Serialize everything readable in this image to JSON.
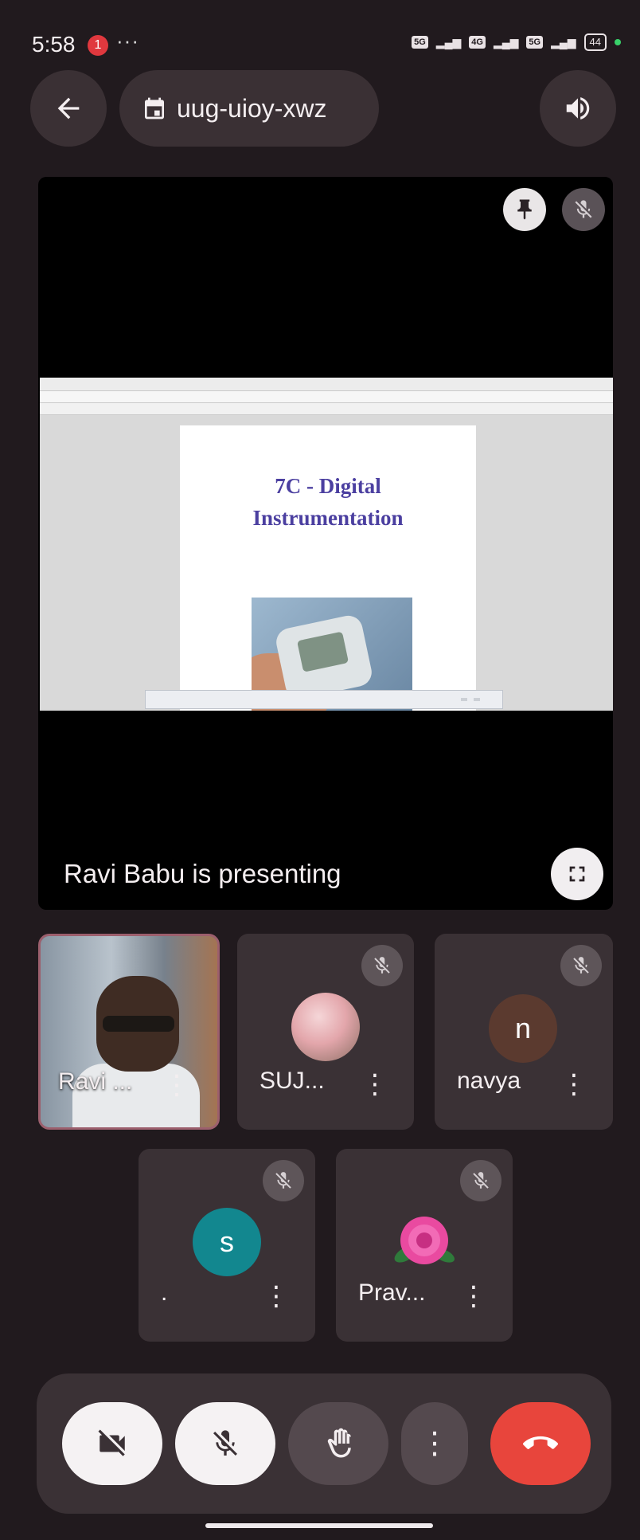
{
  "status_bar": {
    "time": "5:58",
    "notification_count": "1",
    "more": "···",
    "network_chips": [
      "5G",
      "4G",
      "5G"
    ],
    "battery": "44"
  },
  "top_bar": {
    "meeting_code": "uug-uioy-xwz"
  },
  "presentation": {
    "presenting_label": "Ravi Babu is presenting",
    "slide_title_line1": "7C - Digital",
    "slide_title_line2": "Instrumentation"
  },
  "participants": [
    {
      "name": "Ravi ...",
      "avatar_type": "video",
      "muted": false
    },
    {
      "name": "SUJ...",
      "avatar_type": "photo",
      "muted": true
    },
    {
      "name": "navya",
      "avatar_type": "letter",
      "letter": "n",
      "avatar_color": "#5b3a2f",
      "muted": true
    },
    {
      "name": ".",
      "avatar_type": "letter",
      "letter": "s",
      "avatar_color": "#12878f",
      "muted": true
    },
    {
      "name": "Prav...",
      "avatar_type": "flower",
      "muted": true
    }
  ],
  "controls": {
    "camera": "camera-off-icon",
    "mic": "mic-off-icon",
    "raise_hand": "hand-icon",
    "more": "more-vert-icon",
    "end_call": "call-end-icon"
  },
  "colors": {
    "background": "#211a1e",
    "tile": "#3a3135",
    "end_call": "#e8453c",
    "slide_title": "#4b3fa0"
  }
}
